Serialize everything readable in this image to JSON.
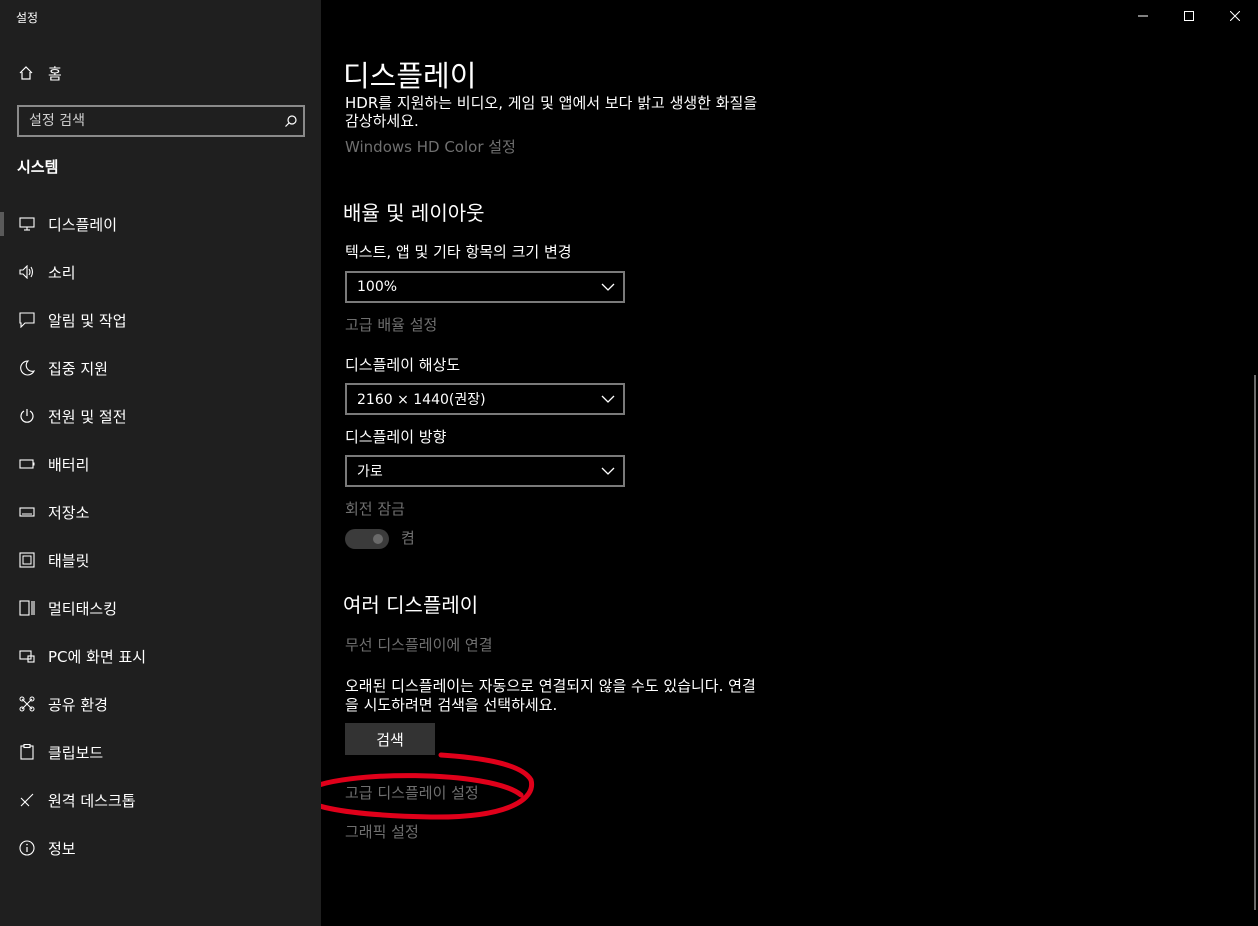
{
  "window": {
    "title": "설정"
  },
  "sidebar": {
    "home_label": "홈",
    "search_placeholder": "설정 검색",
    "section_label": "시스템",
    "items": [
      {
        "label": "디스플레이",
        "icon": "monitor-icon",
        "active": true
      },
      {
        "label": "소리",
        "icon": "speaker-icon"
      },
      {
        "label": "알림 및 작업",
        "icon": "notification-icon"
      },
      {
        "label": "집중 지원",
        "icon": "moon-icon"
      },
      {
        "label": "전원 및 절전",
        "icon": "power-icon"
      },
      {
        "label": "배터리",
        "icon": "battery-icon"
      },
      {
        "label": "저장소",
        "icon": "storage-icon"
      },
      {
        "label": "태블릿",
        "icon": "tablet-icon"
      },
      {
        "label": "멀티태스킹",
        "icon": "multitasking-icon"
      },
      {
        "label": "PC에 화면 표시",
        "icon": "project-icon"
      },
      {
        "label": "공유 환경",
        "icon": "shared-experiences-icon"
      },
      {
        "label": "클립보드",
        "icon": "clipboard-icon"
      },
      {
        "label": "원격 데스크톱",
        "icon": "remote-desktop-icon"
      },
      {
        "label": "정보",
        "icon": "info-icon"
      }
    ]
  },
  "main": {
    "title": "디스플레이",
    "hdr_text_line1": "HDR를 지원하는 비디오, 게임 및 앱에서 보다 밝고 생생한 화질을",
    "hdr_text_line2": "감상하세요.",
    "hdr_link": "Windows HD Color 설정",
    "scale_section": "배율 및 레이아웃",
    "scale_label": "텍스트, 앱 및 기타 항목의 크기 변경",
    "scale_value": "100%",
    "advanced_scale_link": "고급 배율 설정",
    "resolution_label": "디스플레이 해상도",
    "resolution_value": "2160 × 1440(권장)",
    "orientation_label": "디스플레이 방향",
    "orientation_value": "가로",
    "rotation_lock_label": "회전 잠금",
    "rotation_lock_state": "켬",
    "multi_section": "여러 디스플레이",
    "wireless_link": "무선 디스플레이에 연결",
    "detect_text_line1": "오래된 디스플레이는 자동으로 연결되지 않을 수도 있습니다. 연결",
    "detect_text_line2": "을 시도하려면 검색을 선택하세요.",
    "detect_button": "검색",
    "advanced_display_link": "고급 디스플레이 설정",
    "graphics_link": "그래픽 설정"
  },
  "colors": {
    "sidebar_bg": "#1f1f1f",
    "main_bg": "#000000",
    "muted_text": "#6f6f6f",
    "annotation": "#e0001a"
  }
}
